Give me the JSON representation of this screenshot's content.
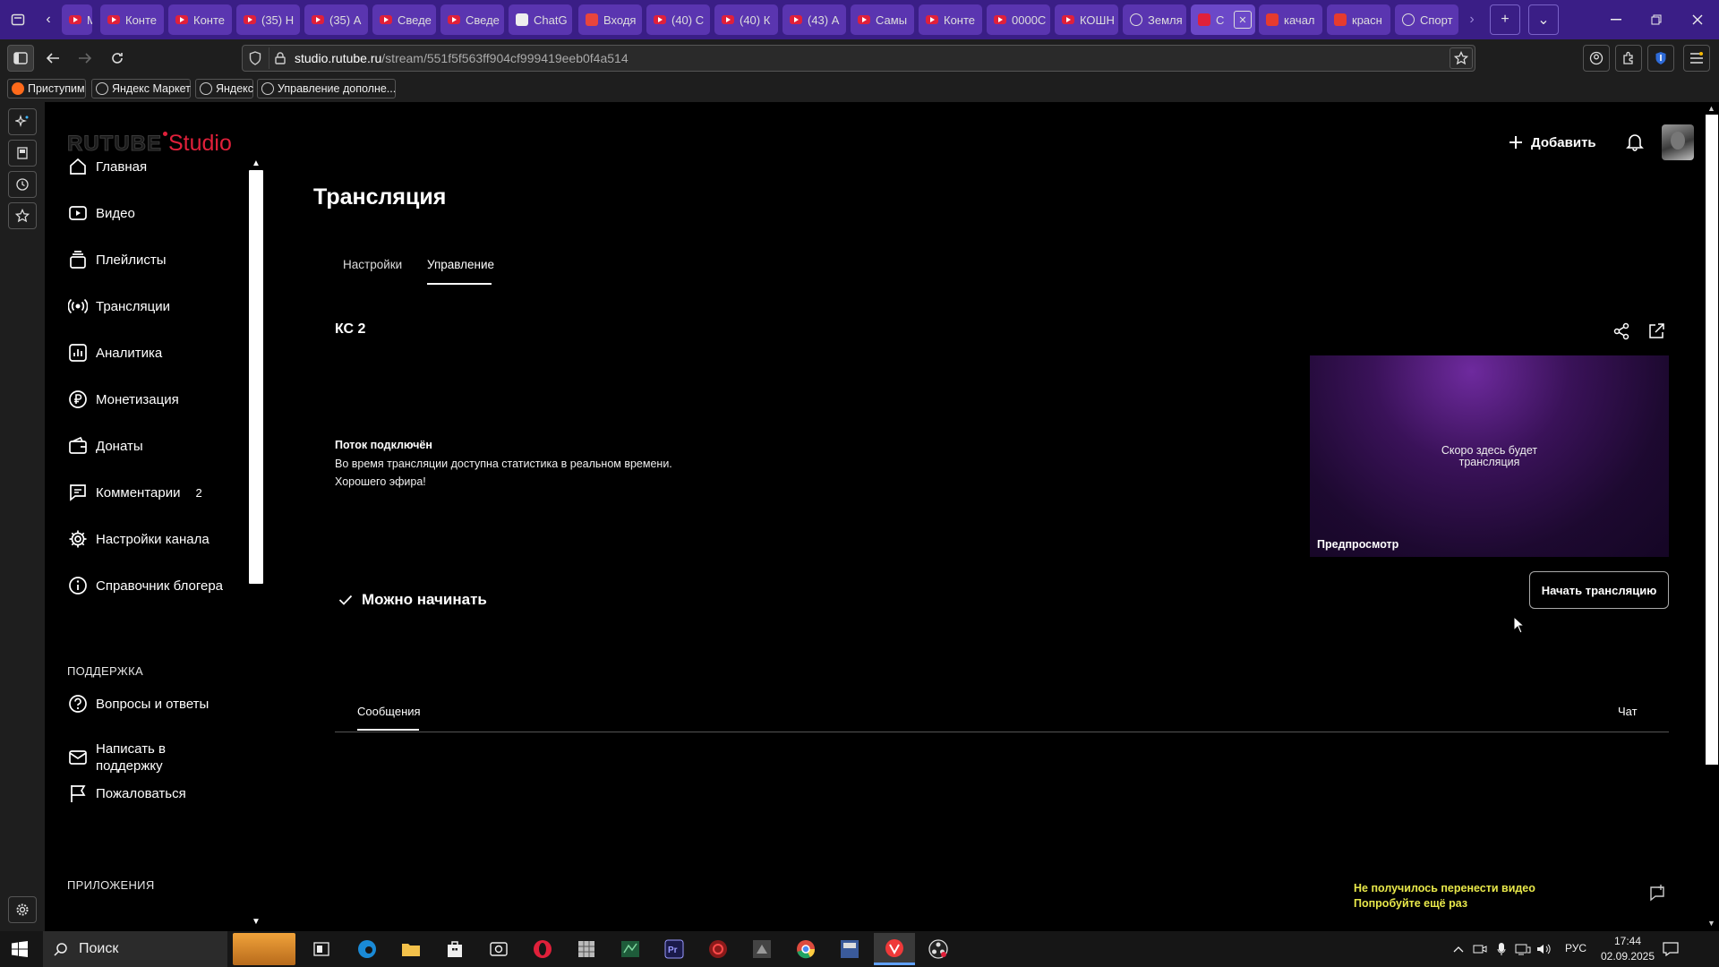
{
  "browser": {
    "tabs": [
      {
        "label": "Мо",
        "fav": "youtube"
      },
      {
        "label": "Конте",
        "fav": "youtube"
      },
      {
        "label": "Конте",
        "fav": "youtube"
      },
      {
        "label": "(35) Н",
        "fav": "youtube"
      },
      {
        "label": "(35) А",
        "fav": "youtube"
      },
      {
        "label": "Сведе",
        "fav": "youtube"
      },
      {
        "label": "Сведе",
        "fav": "youtube"
      },
      {
        "label": "ChatG",
        "fav": "chatgpt"
      },
      {
        "label": "Входя",
        "fav": "gmail"
      },
      {
        "label": "(40) С",
        "fav": "youtube"
      },
      {
        "label": "(40) К",
        "fav": "youtube"
      },
      {
        "label": "(43) А",
        "fav": "youtube"
      },
      {
        "label": "Самы",
        "fav": "youtube"
      },
      {
        "label": "Конте",
        "fav": "youtube"
      },
      {
        "label": "0000С",
        "fav": "youtube"
      },
      {
        "label": "КОШН",
        "fav": "youtube"
      },
      {
        "label": "Земля",
        "fav": "info"
      },
      {
        "label": "С",
        "fav": "studio"
      },
      {
        "label": "качал",
        "fav": "yandex"
      },
      {
        "label": "красн",
        "fav": "yandex"
      },
      {
        "label": "Спорт",
        "fav": "globe"
      }
    ],
    "url_host": "studio.rutube.ru",
    "url_path": "/stream/551f5f563ff904cf999419eeb0f4a514",
    "bookmarks": [
      "Приступим",
      "Яндекс Маркет",
      "Яндекс",
      "Управление дополне..."
    ]
  },
  "app": {
    "logo_main": "RUTUBE",
    "logo_sub": "Studio",
    "add_label": "Добавить",
    "brand_color": "#e0203a"
  },
  "sidebar": {
    "items": [
      {
        "label": "Главная",
        "icon": "home-icon"
      },
      {
        "label": "Видео",
        "icon": "video-icon"
      },
      {
        "label": "Плейлисты",
        "icon": "playlist-icon"
      },
      {
        "label": "Трансляции",
        "icon": "broadcast-icon"
      },
      {
        "label": "Аналитика",
        "icon": "analytics-icon"
      },
      {
        "label": "Монетизация",
        "icon": "money-icon"
      },
      {
        "label": "Донаты",
        "icon": "wallet-icon"
      },
      {
        "label": "Комментарии",
        "icon": "comment-icon",
        "badge": "2"
      },
      {
        "label": "Настройки канала",
        "icon": "gear-icon"
      },
      {
        "label": "Справочник блогера",
        "icon": "info-icon"
      }
    ],
    "support_heading": "ПОДДЕРЖКА",
    "support": [
      {
        "label": "Вопросы и ответы",
        "icon": "question-icon"
      },
      {
        "label_line1": "Написать в",
        "label_line2": "поддержку",
        "icon": "mail-icon"
      },
      {
        "label": "Пожаловаться",
        "icon": "flag-icon"
      }
    ],
    "apps_heading": "ПРИЛОЖЕНИЯ"
  },
  "main": {
    "title": "Трансляция",
    "tabs": [
      "Настройки",
      "Управление"
    ],
    "active_tab": "Управление",
    "stream_name": "КС 2",
    "status_title": "Поток подключён",
    "status_line1": "Во время трансляции доступна статистика в реальном времени.",
    "status_line2": "Хорошего эфира!",
    "ready_label": "Можно начинать",
    "start_button": "Начать трансляцию",
    "preview_text_line1": "Скоро здесь будет",
    "preview_text_line2": "трансляция",
    "preview_label": "Предпросмотр",
    "bottom_tabs": {
      "left": "Сообщения",
      "right": "Чат"
    },
    "toast_line1": "Не получилось перенести видео",
    "toast_line2": "Попробуйте ещё раз",
    "toast_color": "#e8e84a"
  },
  "taskbar": {
    "search_label": "Поиск",
    "lang": "РУС",
    "time": "17:44",
    "date": "02.09.2025"
  }
}
